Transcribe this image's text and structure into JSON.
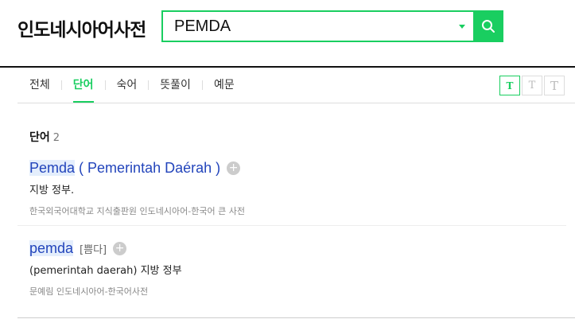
{
  "header": {
    "logo": "인도네시아어사전",
    "search_value": "PEMDA"
  },
  "tabs": [
    {
      "label": "전체"
    },
    {
      "label": "단어"
    },
    {
      "label": "숙어"
    },
    {
      "label": "뜻풀이"
    },
    {
      "label": "예문"
    }
  ],
  "font_size_buttons": [
    "T",
    "T",
    "T"
  ],
  "section": {
    "title": "단어",
    "count": "2"
  },
  "entries": [
    {
      "headword_highlight": "Pemda",
      "headword_rest": " ( Pemerintah Daérah )",
      "pron": "",
      "meaning": "지방 정부.",
      "source": "한국외국어대학교 지식출판원 인도네시아어-한국어 큰 사전"
    },
    {
      "headword_highlight": "pemda",
      "headword_rest": "",
      "pron": "[쁨다]",
      "meaning": "(pemerintah daerah) 지방 정부",
      "source": "문예림 인도네시아어-한국어사전"
    }
  ],
  "colors": {
    "accent": "#19ce60",
    "link": "#2244bb"
  }
}
